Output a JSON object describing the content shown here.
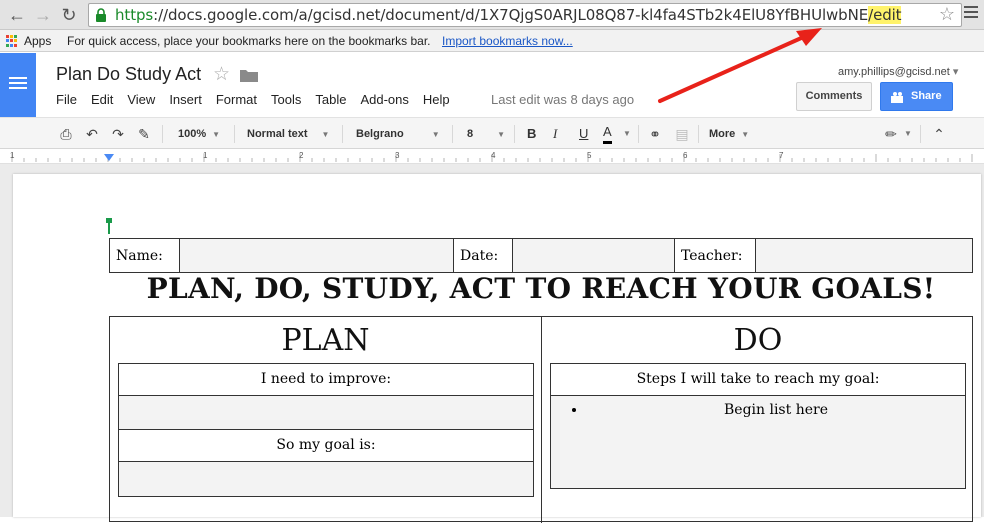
{
  "browser": {
    "url_scheme": "https",
    "url_rest": "://docs.google.com/a/gcisd.net/document/d/1X7QjgS0ARJL08Q87-kl4fa4STb2k4ElU8YfBHUlwbNE",
    "url_highlight": "/edit",
    "bookmarks": {
      "apps_label": "Apps",
      "hint": "For quick access, place your bookmarks here on the bookmarks bar.",
      "import_link": "Import bookmarks now..."
    }
  },
  "docs": {
    "title": "Plan Do Study Act",
    "menu": [
      "File",
      "Edit",
      "View",
      "Insert",
      "Format",
      "Tools",
      "Table",
      "Add-ons",
      "Help"
    ],
    "last_edit": "Last edit was 8 days ago",
    "user_email": "amy.phillips@gcisd.net",
    "comments_label": "Comments",
    "share_label": "Share",
    "accent_color": "#4285f4"
  },
  "toolbar": {
    "zoom": "100%",
    "style": "Normal text",
    "font": "Belgrano",
    "size": "8",
    "bold": "B",
    "italic": "I",
    "underline": "U",
    "text_color": "A",
    "more": "More"
  },
  "ruler": {
    "numbers": [
      "1",
      "1",
      "2",
      "3",
      "4",
      "5",
      "6",
      "7"
    ]
  },
  "document": {
    "info": {
      "name_label": "Name:",
      "date_label": "Date:",
      "teacher_label": "Teacher:"
    },
    "heading": "PLAN, DO, STUDY, ACT TO REACH YOUR GOALS!",
    "plan": {
      "title": "PLAN",
      "improve_label": "I need to improve:",
      "goal_label": "So my goal is:"
    },
    "do": {
      "title": "DO",
      "steps_label": "Steps I will take to reach my goal:",
      "bullet": "Begin list here"
    }
  }
}
